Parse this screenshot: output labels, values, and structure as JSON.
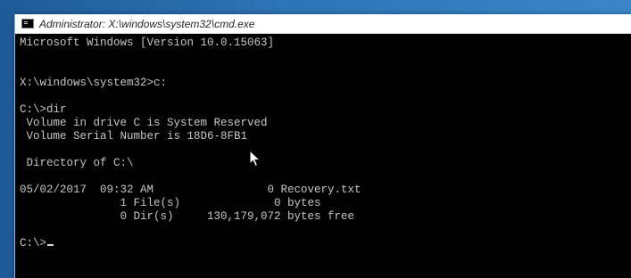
{
  "window": {
    "title": "Administrator: X:\\windows\\system32\\cmd.exe"
  },
  "console": {
    "lines": [
      "Microsoft Windows [Version 10.0.15063]",
      "",
      "",
      "X:\\windows\\system32>c:",
      "",
      "C:\\>dir",
      " Volume in drive C is System Reserved",
      " Volume Serial Number is 18D6-8FB1",
      "",
      " Directory of C:\\",
      "",
      "05/02/2017  09:32 AM                 0 Recovery.txt",
      "               1 File(s)              0 bytes",
      "               0 Dir(s)     130,179,072 bytes free",
      "",
      "C:\\>"
    ]
  },
  "icons": {
    "app": "console-icon",
    "pointer": "mouse-pointer-icon"
  }
}
